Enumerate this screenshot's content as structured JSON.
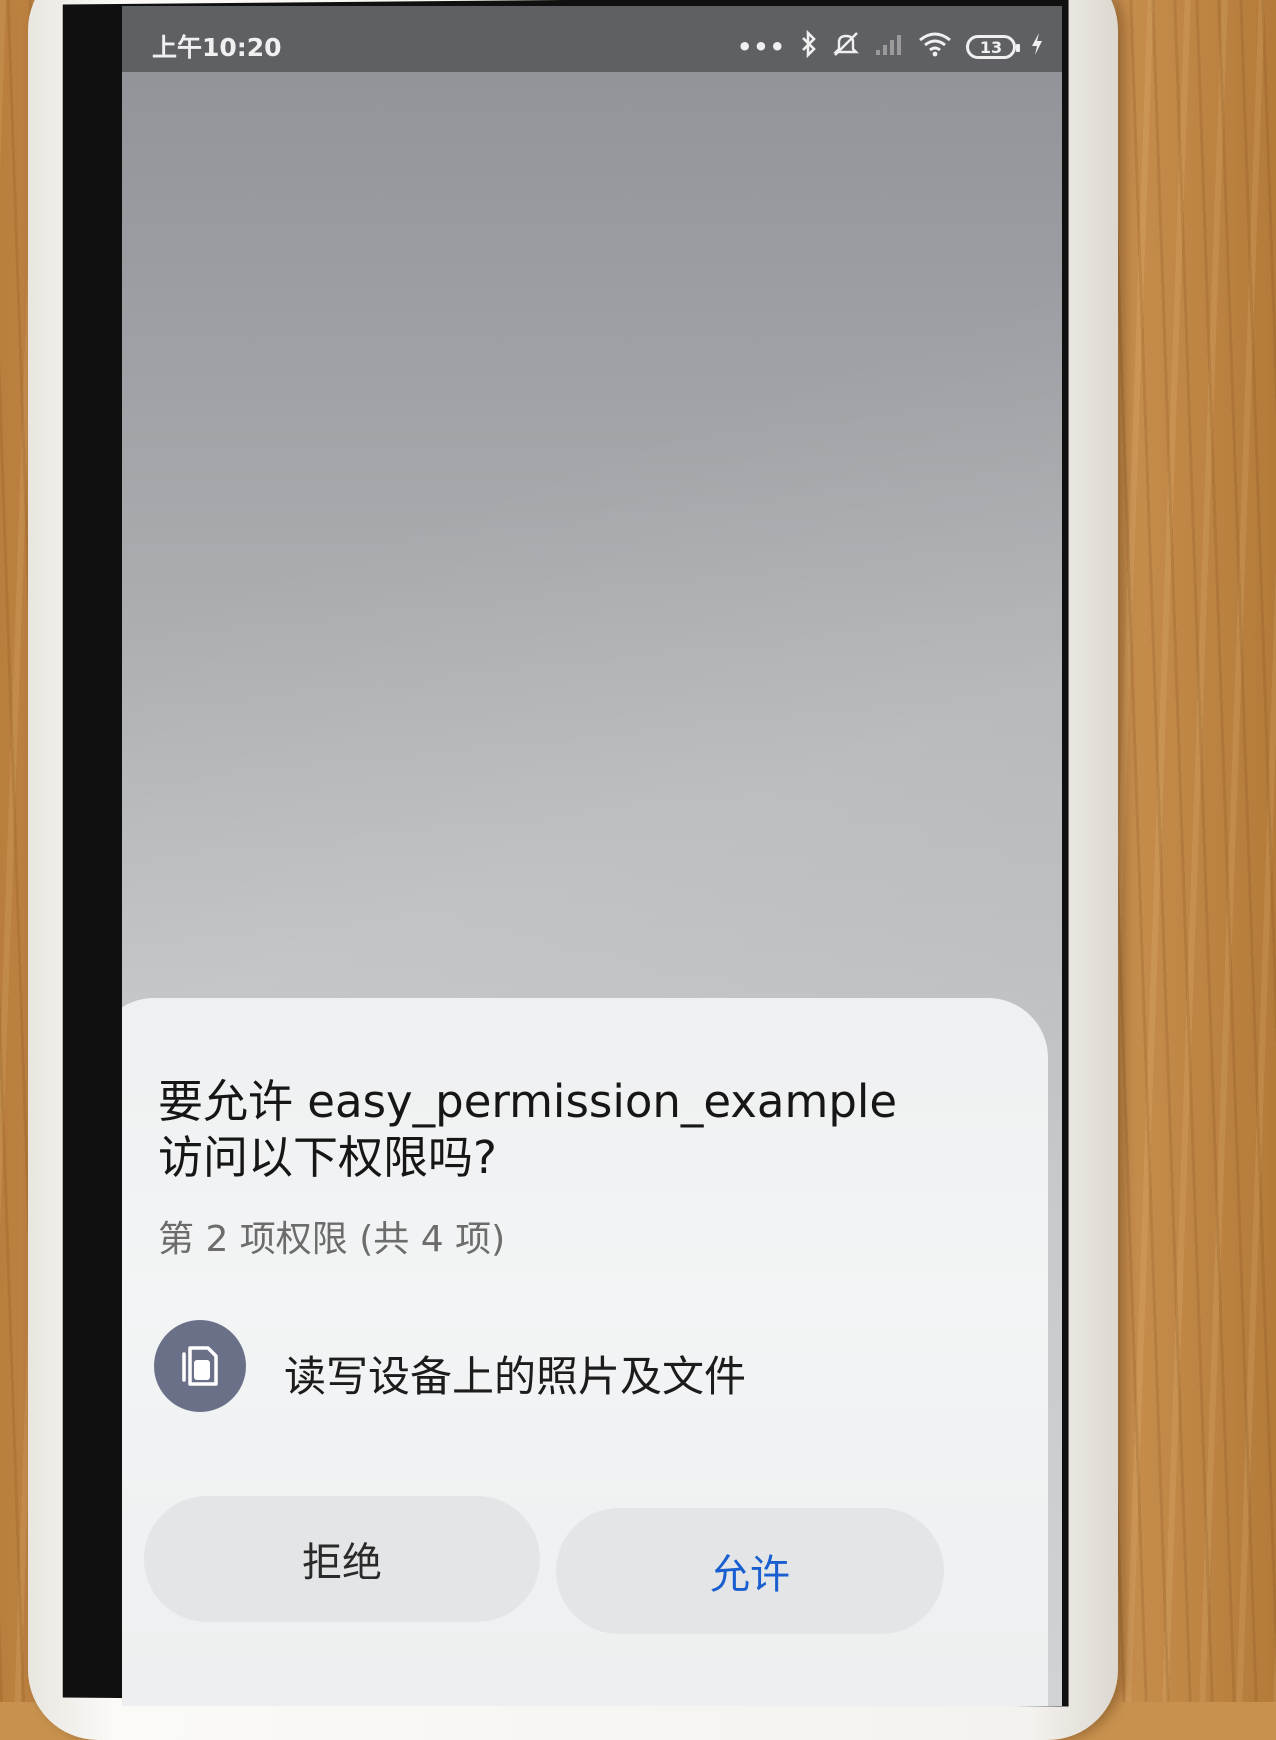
{
  "status_bar": {
    "time": "上午10:20",
    "dots": "•••",
    "battery_level": "13",
    "icons": [
      "bluetooth-icon",
      "mute-icon",
      "signal-icon",
      "wifi-icon",
      "battery-icon",
      "charging-icon"
    ]
  },
  "dialog": {
    "title": "要允许 easy_permission_example 访问以下权限吗?",
    "subtitle": "第 2 项权限 (共 4 项)",
    "permission": {
      "icon": "storage-icon",
      "label": "读写设备上的照片及文件"
    },
    "deny_label": "拒绝",
    "allow_label": "允许"
  },
  "colors": {
    "allow_text": "#1a5fd0",
    "permission_icon_bg": "#6a7088",
    "status_bar_bg": "#5e6064"
  }
}
